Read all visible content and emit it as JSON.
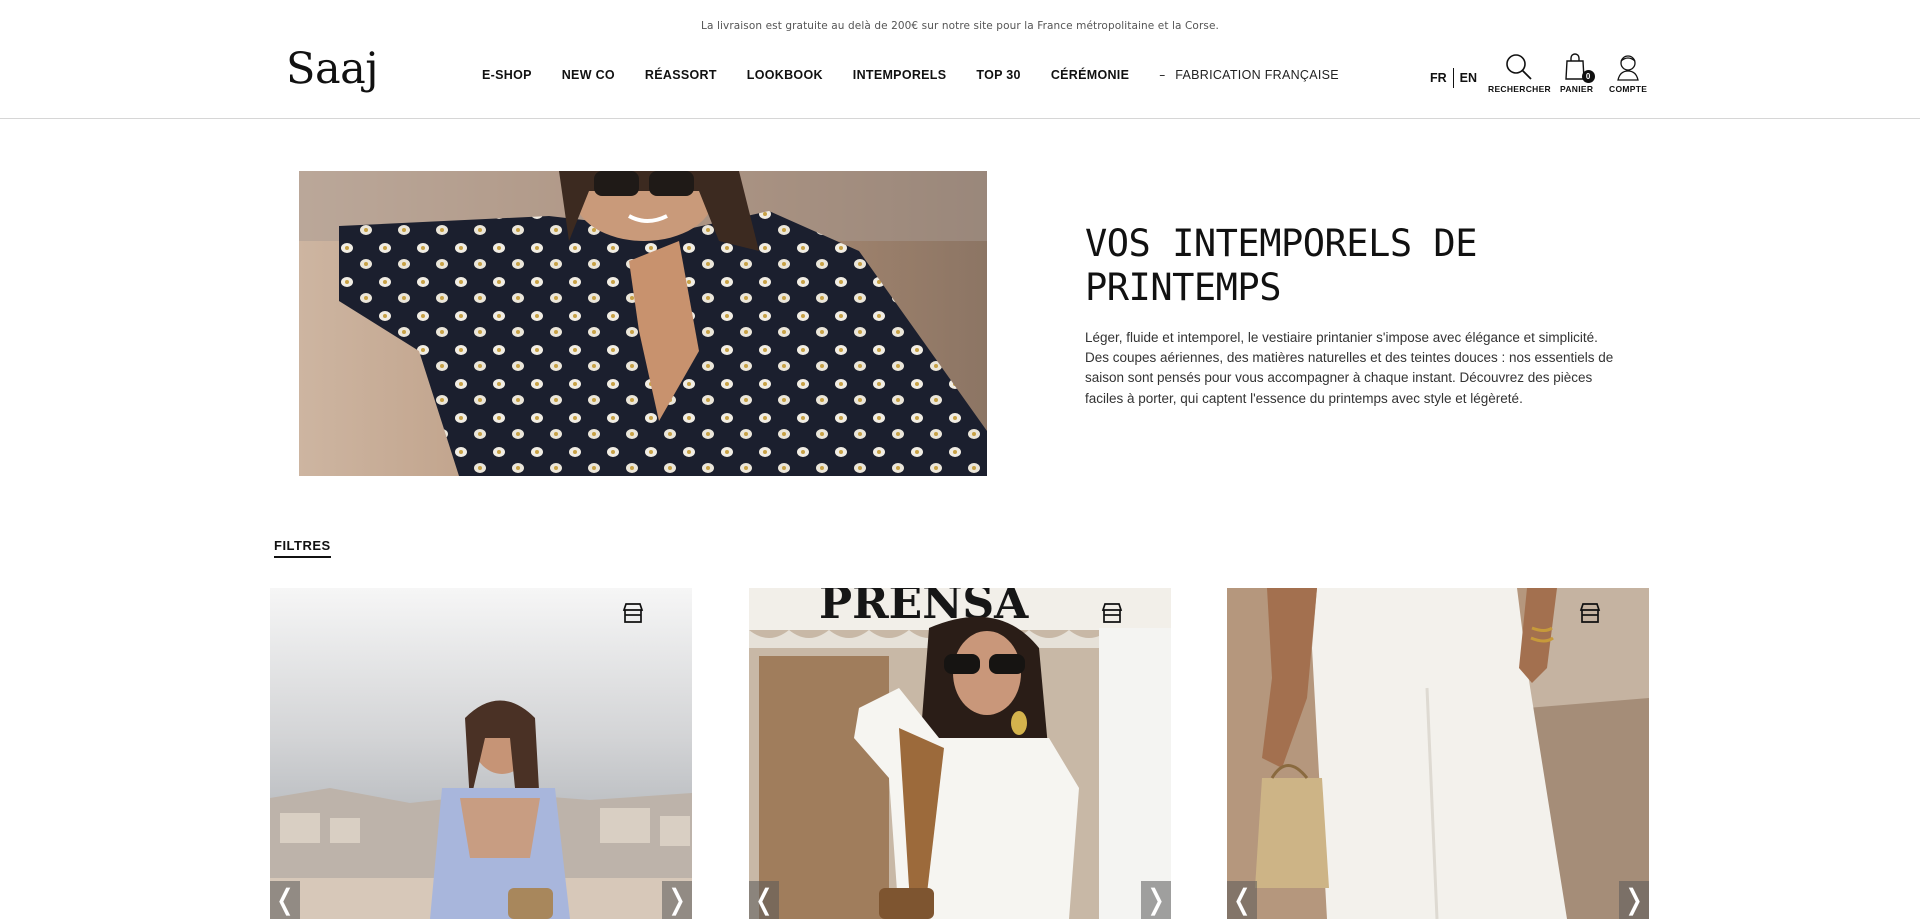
{
  "announcement": "La livraison est gratuite au delà de 200€ sur notre site pour la France métropolitaine et la Corse.",
  "brand": {
    "logo_text": "Saaj"
  },
  "nav": {
    "items": [
      "E-SHOP",
      "NEW CO",
      "RÉASSORT",
      "LOOKBOOK",
      "INTEMPORELS",
      "TOP 30",
      "CÉRÉMONIE"
    ],
    "dash": "–",
    "extra": "FABRICATION FRANÇAISE"
  },
  "lang": {
    "active": "FR",
    "other": "EN"
  },
  "utility": {
    "search_label": "RECHERCHER",
    "cart_label": "PANIER",
    "cart_count": "0",
    "account_label": "COMPTE"
  },
  "hero": {
    "title": "VOS INTEMPORELS DE PRINTEMPS",
    "text": "Léger, fluide et intemporel, le vestiaire printanier s'impose avec élégance et simplicité. Des coupes aériennes, des matières naturelles et des teintes douces : nos essentiels de saison sont pensés pour vous accompagner à chaque instant. Découvrez des pièces faciles à porter, qui captent l'essence du printemps avec style et légèreté."
  },
  "filters_label": "FILTRES",
  "products": [
    {
      "arrow_prev": "❬",
      "arrow_next": "❭",
      "icon": "store-icon"
    },
    {
      "arrow_prev": "❬",
      "arrow_next": "❭",
      "icon": "store-icon",
      "sign_text": "PRENSA"
    },
    {
      "arrow_prev": "❬",
      "arrow_next": "❭",
      "icon": "store-icon"
    }
  ],
  "colors": {
    "accent": "#111111",
    "divider": "#d6d6d6",
    "arrow_bg": "#5a5a5a"
  }
}
